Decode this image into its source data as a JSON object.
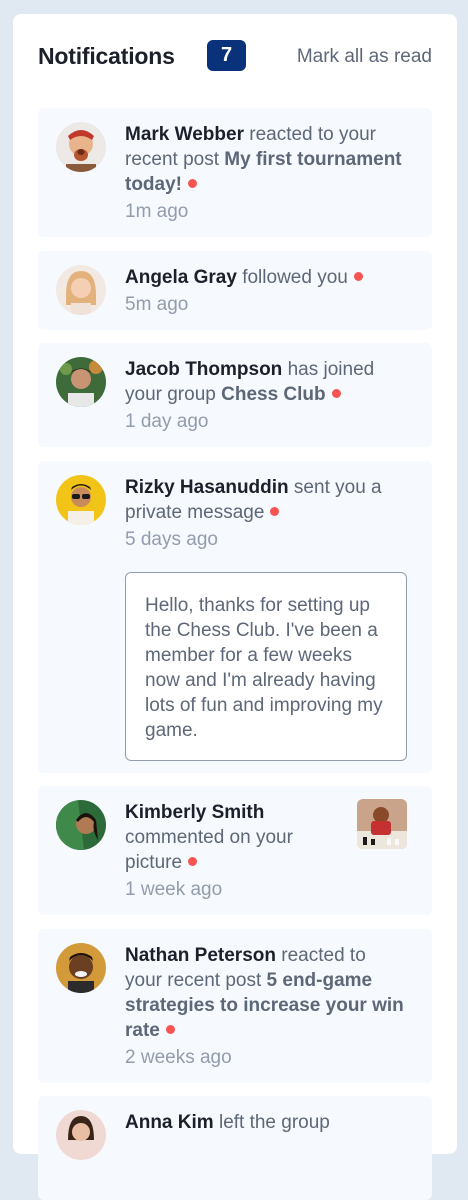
{
  "header": {
    "title": "Notifications",
    "count": "7",
    "mark_all_label": "Mark all as read"
  },
  "notifications": [
    {
      "name": "Mark Webber",
      "action": " reacted to your recent post ",
      "object": "My first tournament today!",
      "time": "1m ago",
      "unread": true
    },
    {
      "name": "Angela Gray",
      "action": " followed you",
      "object": "",
      "time": "5m ago",
      "unread": true
    },
    {
      "name": "Jacob Thompson",
      "action": " has joined your group ",
      "object": "Chess Club",
      "time": "1 day ago",
      "unread": true
    },
    {
      "name": "Rizky Hasanuddin",
      "action": " sent you a private message",
      "object": "",
      "time": "5 days ago",
      "unread": true,
      "message": "Hello, thanks for setting up the Chess Club. I've been a member for a few weeks now and I'm already having lots of fun and improving my game."
    },
    {
      "name": "Kimberly Smith",
      "action": " commented on your picture",
      "object": "",
      "time": "1 week ago",
      "unread": true
    },
    {
      "name": "Nathan Peterson",
      "action": " reacted to your recent post ",
      "object": "5 end-game strategies to increase your win rate",
      "time": "2 weeks ago",
      "unread": true
    },
    {
      "name": "Anna Kim",
      "action": " left the group",
      "object": "",
      "time": "",
      "unread": false
    }
  ],
  "colors": {
    "accent": "#0a327b",
    "unread_dot": "#f65552",
    "item_bg": "#f6f9fd",
    "page_bg": "#e0e8f1"
  }
}
